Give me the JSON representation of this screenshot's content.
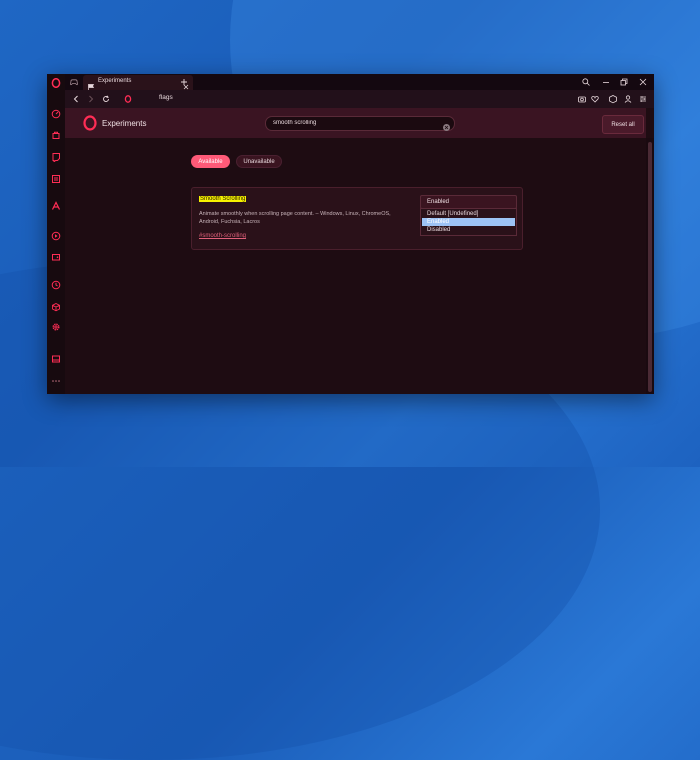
{
  "colors": {
    "accent": "#ff2d55",
    "card_bg": "#2a1119",
    "highlight": "#f6f200",
    "selected_option": "#9dc3f5"
  },
  "sidebar": {
    "icons": [
      "opera-logo-icon",
      "speed-dial-icon",
      "shopping-icon",
      "twitch-icon",
      "news-icon",
      "aria-icon",
      "player-icon",
      "wallet-icon",
      "history-icon",
      "cube-icon",
      "settings-icon",
      "wallet-card-icon",
      "more-icon"
    ]
  },
  "tabbar": {
    "tab_title": "Experiments"
  },
  "addressbar": {
    "url": "flags"
  },
  "header": {
    "title": "Experiments",
    "search_value": "smooth scrolling",
    "reset_label": "Reset all"
  },
  "filters": {
    "available": "Available",
    "unavailable": "Unavailable"
  },
  "flag": {
    "name": "Smooth Scrolling",
    "description": "Animate smoothly when scrolling page content. – Windows, Linux, ChromeOS, Android, Fuchsia, Lacros",
    "link": "#smooth-scrolling",
    "selected_value": "Enabled",
    "options": [
      "Default [Undefined]",
      "Enabled",
      "Disabled"
    ]
  }
}
